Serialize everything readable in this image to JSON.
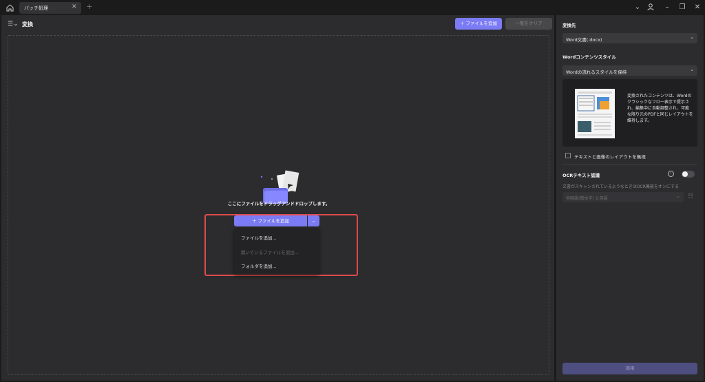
{
  "tab": {
    "label": "バッチ処理"
  },
  "toolbar": {
    "title": "変換",
    "add_file": "ファイルを追加",
    "clear_list": "一覧をクリア"
  },
  "dropzone": {
    "hint": "ここにファイルをドラッグアンドドロップします。",
    "add_button": "ファイルを追加",
    "menu": [
      {
        "label": "ファイルを追加...",
        "enabled": true
      },
      {
        "label": "開いているファイルを追加...",
        "enabled": false
      },
      {
        "label": "フォルダを追加...",
        "enabled": true
      }
    ]
  },
  "side": {
    "target_label": "変換先",
    "target_value": "Word文書(.docx)",
    "style_label": "Wordコンテンツスタイル",
    "style_value": "Wordの流れるスタイルを保持",
    "preview_text": "変換されたコンテンツは、Wordのクラシックなフロー表示で提示され、編集中に自動調整され、可能な限り元のPDFと同じレイアウトを維持します。",
    "ignore_layout": "テキストと画像のレイアウトを無視",
    "ocr_label": "OCRテキスト認識",
    "ocr_desc": "文書がスキャンされているようなときはOCR機能をオンにする",
    "ocr_lang": "中国語(簡体字) と英語",
    "apply": "適用"
  },
  "colors": {
    "accent": "#7b7bf5",
    "highlight": "#e04b4b",
    "panel": "#2c2c2e",
    "background": "#1b1b1c"
  }
}
